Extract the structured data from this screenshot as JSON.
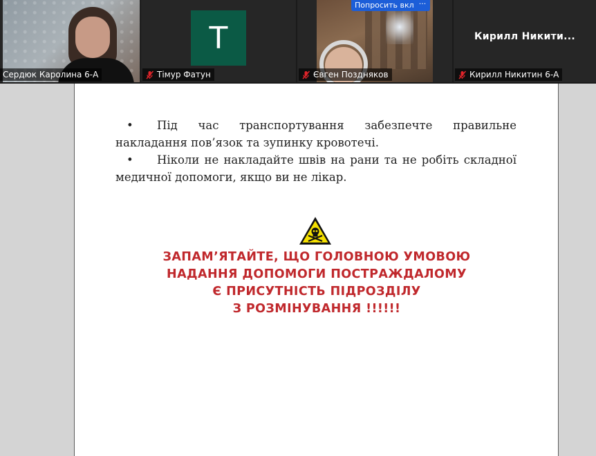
{
  "participants": [
    {
      "name": "Сердюк Каролина 6-А",
      "muted": false
    },
    {
      "name": "Тімур Фатун",
      "avatar_letter": "Т",
      "avatar_color": "#0b5a45",
      "muted": true
    },
    {
      "name": "Євген Поздняков",
      "muted": true,
      "buttons": {
        "ask_unmute": "Попросить вкл",
        "more": "···"
      }
    },
    {
      "name": "Кирилл Никитин 6-А",
      "display_name": "Кирилл  Никити...",
      "muted": true
    }
  ],
  "document": {
    "bullets": [
      {
        "marker": "•",
        "text": "Під час транспортування забезпечте правильне накладання пов’язок та зупинку кровотечі."
      },
      {
        "marker": "•",
        "text": "Ніколи не накладайте швів на рани та не робіть складної медичної допомоги, якщо ви не лікар."
      }
    ],
    "warning_icon": "biohazard-skull-warning-icon",
    "notice_lines": [
      "ЗАПАМ’ЯТАЙТЕ, ЩО ГОЛОВНОЮ УМОВОЮ",
      "НАДАННЯ ДОПОМОГИ ПОСТРАЖДАЛОМУ",
      "Є ПРИСУТНІСТЬ ПІДРОЗДІЛУ",
      "З РОЗМІНУВАННЯ !!!!!!"
    ],
    "notice_color": "#c0282c"
  }
}
